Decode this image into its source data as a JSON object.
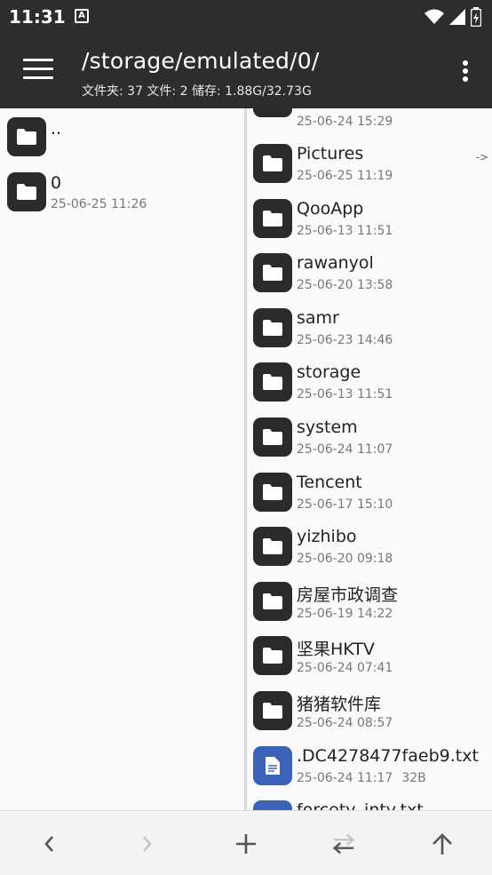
{
  "status": {
    "time": "11:31",
    "notif_glyph": "A"
  },
  "header": {
    "path": "/storage/emulated/0/",
    "summary": "文件夹: 37  文件: 2  储存: 1.88G/32.73G"
  },
  "left_pane": {
    "items": [
      {
        "name": "..",
        "date": ""
      },
      {
        "name": "0",
        "date": "25-06-25 11:26"
      }
    ]
  },
  "right_pane": {
    "partial_top_date": "25-06-24 15:29",
    "items": [
      {
        "name": "Pictures",
        "date": "25-06-25 11:19",
        "type": "folder"
      },
      {
        "name": "QooApp",
        "date": "25-06-13 11:51",
        "type": "folder"
      },
      {
        "name": "rawanyol",
        "date": "25-06-20 13:58",
        "type": "folder"
      },
      {
        "name": "samr",
        "date": "25-06-23 14:46",
        "type": "folder"
      },
      {
        "name": "storage",
        "date": "25-06-13 11:51",
        "type": "folder"
      },
      {
        "name": "system",
        "date": "25-06-24 11:07",
        "type": "folder"
      },
      {
        "name": "Tencent",
        "date": "25-06-17 15:10",
        "type": "folder"
      },
      {
        "name": "yizhibo",
        "date": "25-06-20 09:18",
        "type": "folder"
      },
      {
        "name": "房屋市政调查",
        "date": "25-06-19 14:22",
        "type": "folder"
      },
      {
        "name": "坚果HKTV",
        "date": "25-06-24 07:41",
        "type": "folder"
      },
      {
        "name": "猪猪软件库",
        "date": "25-06-24 08:57",
        "type": "folder"
      },
      {
        "name": ".DC4278477faeb9.txt",
        "date": "25-06-24 11:17",
        "size": "32B",
        "type": "file"
      },
      {
        "name": "forcety_intv.txt",
        "date": "",
        "type": "file"
      }
    ],
    "arrow_marker": "->"
  },
  "colors": {
    "bar": "#2d2d2d",
    "folder_icon": "#2b2b2b",
    "file_icon": "#3b62b8"
  }
}
